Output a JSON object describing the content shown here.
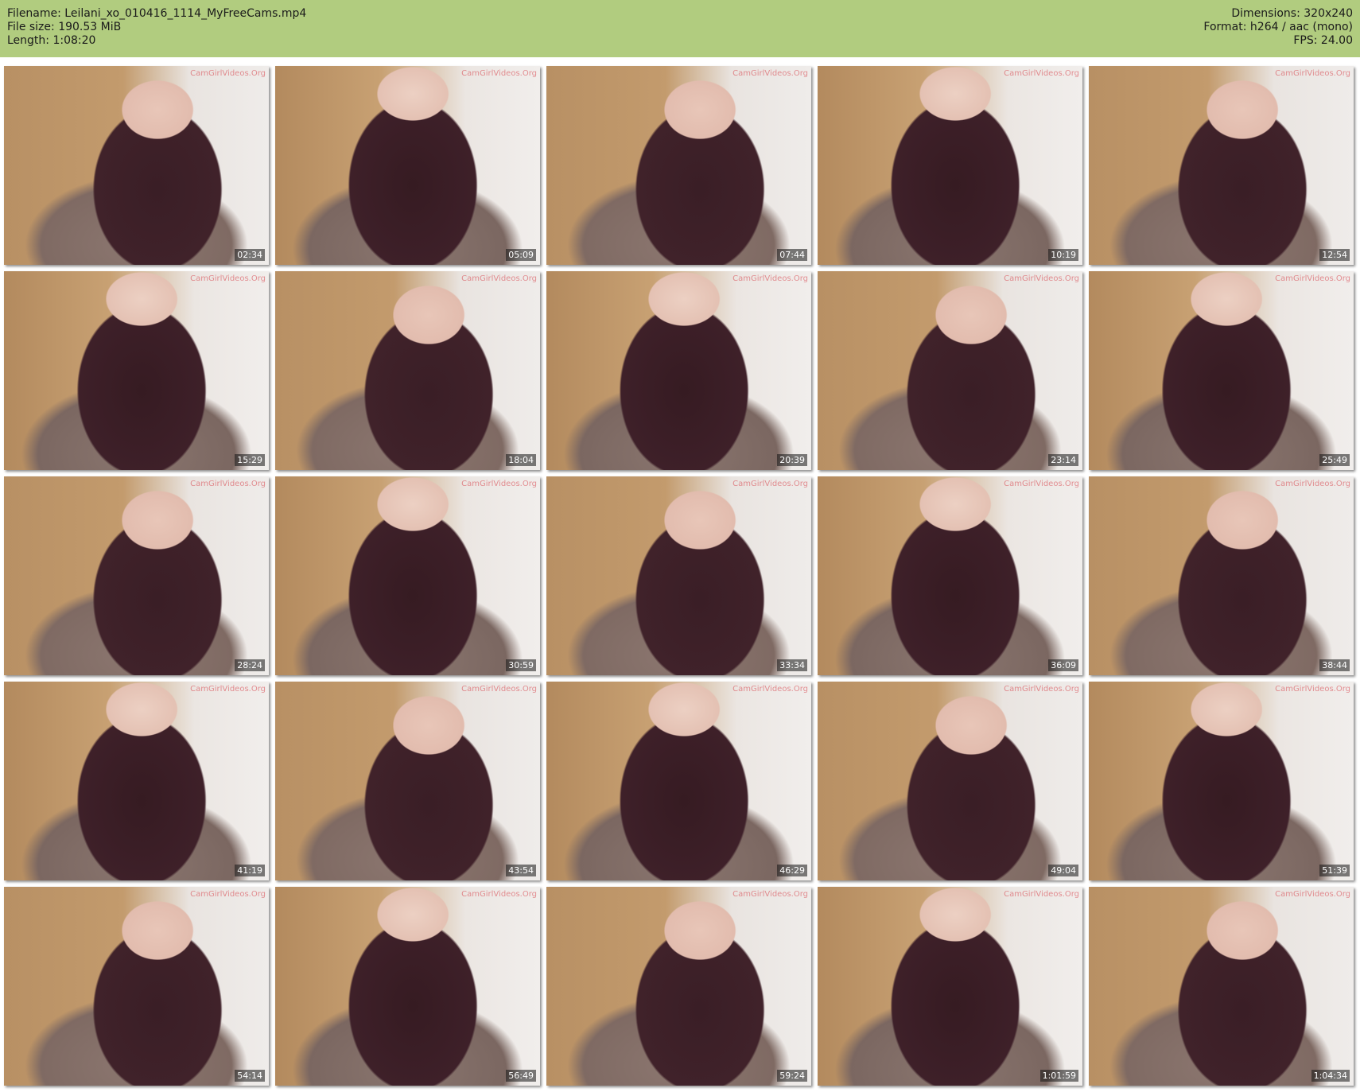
{
  "header": {
    "filename_line": "Filename: Leilani_xo_010416_1114_MyFreeCams.mp4",
    "filesize_line": "File size: 190.53 MiB",
    "length_line": "Length: 1:08:20",
    "dimensions_line": "Dimensions: 320x240",
    "format_line": "Format: h264 / aac (mono)",
    "fps_line": "FPS: 24.00",
    "background_color": "#b1cc7f"
  },
  "watermark_text": "CamGirlVideos.Org",
  "thumbnails": [
    {
      "time": "02:34"
    },
    {
      "time": "05:09"
    },
    {
      "time": "07:44"
    },
    {
      "time": "10:19"
    },
    {
      "time": "12:54"
    },
    {
      "time": "15:29"
    },
    {
      "time": "18:04"
    },
    {
      "time": "20:39"
    },
    {
      "time": "23:14"
    },
    {
      "time": "25:49"
    },
    {
      "time": "28:24"
    },
    {
      "time": "30:59"
    },
    {
      "time": "33:34"
    },
    {
      "time": "36:09"
    },
    {
      "time": "38:44"
    },
    {
      "time": "41:19"
    },
    {
      "time": "43:54"
    },
    {
      "time": "46:29"
    },
    {
      "time": "49:04"
    },
    {
      "time": "51:39"
    },
    {
      "time": "54:14"
    },
    {
      "time": "56:49"
    },
    {
      "time": "59:24"
    },
    {
      "time": "1:01:59"
    },
    {
      "time": "1:04:34"
    }
  ]
}
